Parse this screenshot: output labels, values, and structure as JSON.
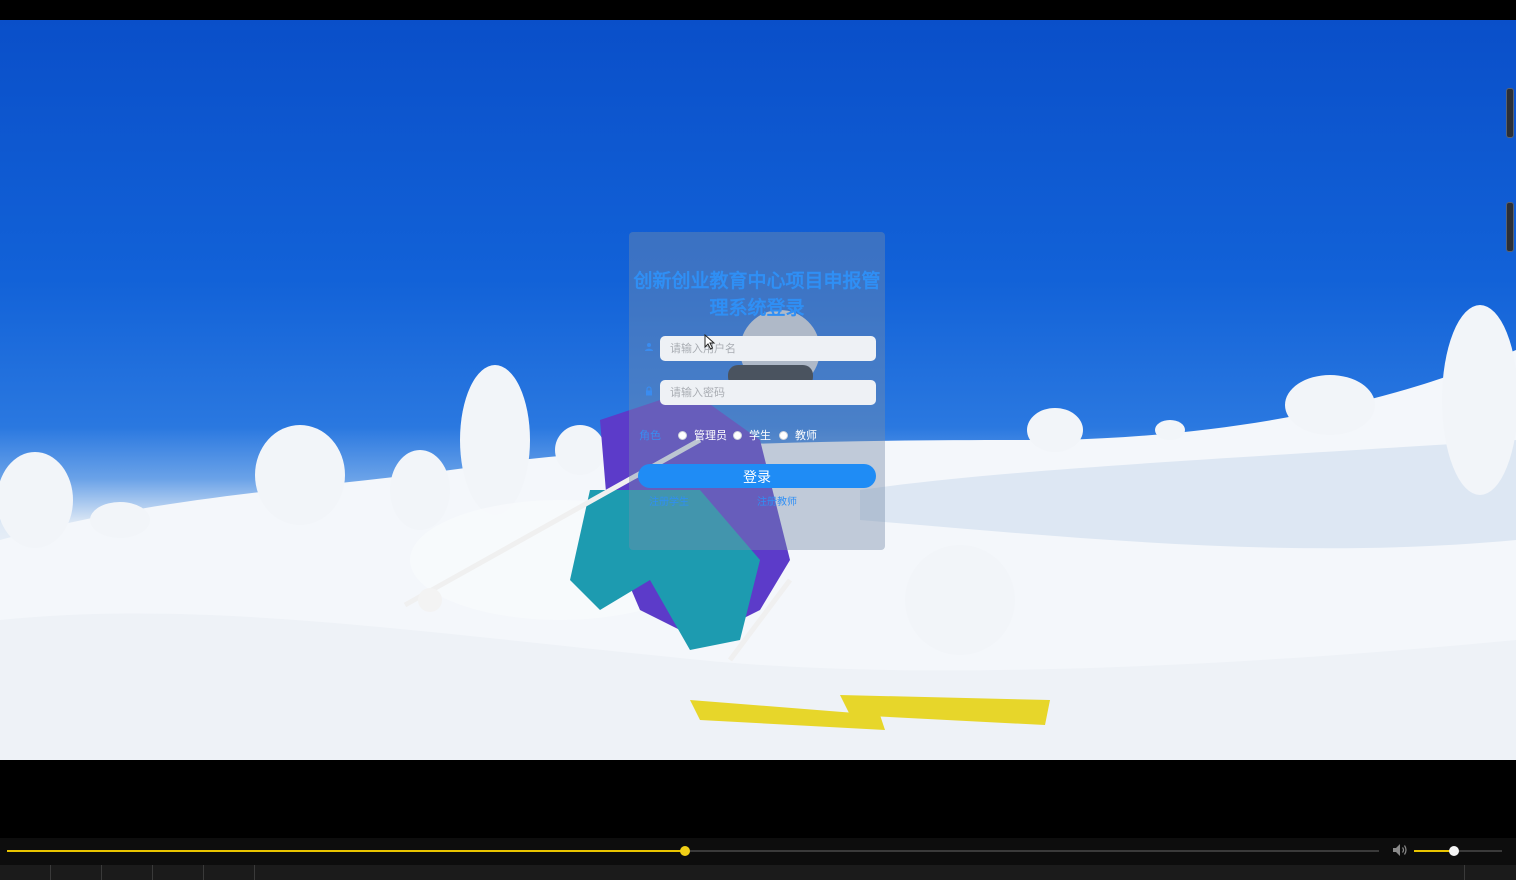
{
  "login": {
    "title": "创新创业教育中心项目申报管理系统登录",
    "username_placeholder": "请输入用户名",
    "password_placeholder": "请输入密码",
    "role_label": "角色",
    "roles": [
      "管理员",
      "学生",
      "教师"
    ],
    "login_label": "登录",
    "register_student": "注册学生",
    "register_teacher": "注册教师"
  },
  "icons": {
    "username": "user-icon",
    "password": "lock-icon",
    "volume": "volume-icon"
  },
  "player": {
    "progress_fraction": 0.494,
    "volume_fraction": 0.45
  },
  "colors": {
    "accent": "#1f8cf5",
    "title": "#2f8ff5",
    "progress": "#e8c400"
  }
}
